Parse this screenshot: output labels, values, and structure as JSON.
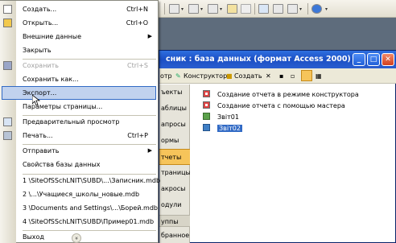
{
  "dbwindow": {
    "title": "сник : база данных (формат Access 2000)"
  },
  "dbtoolbar": {
    "open": "отр",
    "design": "Конструктор",
    "create": "Создать"
  },
  "objects": {
    "items": [
      "ъекты",
      "аблицы",
      "апросы",
      "ормы",
      "тчеты",
      "траницы",
      "акросы",
      "одули"
    ],
    "groups": [
      "уппы",
      "бранное"
    ],
    "selected_index": 4
  },
  "reportlist": [
    {
      "text": "Создание отчета в режиме конструктора",
      "icon": "design-wizard-icon"
    },
    {
      "text": "Создание отчета с помощью мастера",
      "icon": "report-wizard-icon"
    },
    {
      "text": "Звіт01",
      "icon": "report-icon"
    },
    {
      "text": "Звіт02",
      "icon": "report-icon"
    }
  ],
  "menu": {
    "items": [
      {
        "label": "Создать...",
        "shortcut": "Ctrl+N",
        "icon": "new-file-icon"
      },
      {
        "label": "Открыть...",
        "shortcut": "Ctrl+O",
        "icon": "open-folder-icon"
      },
      {
        "label": "Внешние данные",
        "submenu": true
      },
      {
        "label": "Закрыть"
      },
      {
        "label": "Сохранить",
        "shortcut": "Ctrl+S",
        "disabled": true,
        "icon": "save-icon"
      },
      {
        "label": "Сохранить как..."
      },
      {
        "label": "Экспорт...",
        "hovered": true
      },
      {
        "label": "Параметры страницы..."
      },
      {
        "label": "Предварительный просмотр",
        "icon": "print-preview-icon"
      },
      {
        "label": "Печать...",
        "shortcut": "Ctrl+P",
        "icon": "print-icon"
      },
      {
        "label": "Отправить",
        "submenu": true
      },
      {
        "label": "Свойства базы данных"
      },
      {
        "label": "1 \\SiteOfSSchLNIT\\SUBD\\...\\Записник.mdb"
      },
      {
        "label": "2 \\...\\Учащиеся_школы_новые.mdb"
      },
      {
        "label": "3 \\Documents and Settings\\...\\Борей.mdb"
      },
      {
        "label": "4 \\SiteOfSSchLNIT\\SUBD\\Пример01.mdb"
      },
      {
        "label": "Выход"
      }
    ],
    "expand_icon": "double-chevron-down-icon"
  },
  "colors": {
    "menu_highlight": "#c1d2ee",
    "selection": "#316ac5",
    "title_bar": "#1b4fc4",
    "selected_object": "#f6c45a"
  }
}
